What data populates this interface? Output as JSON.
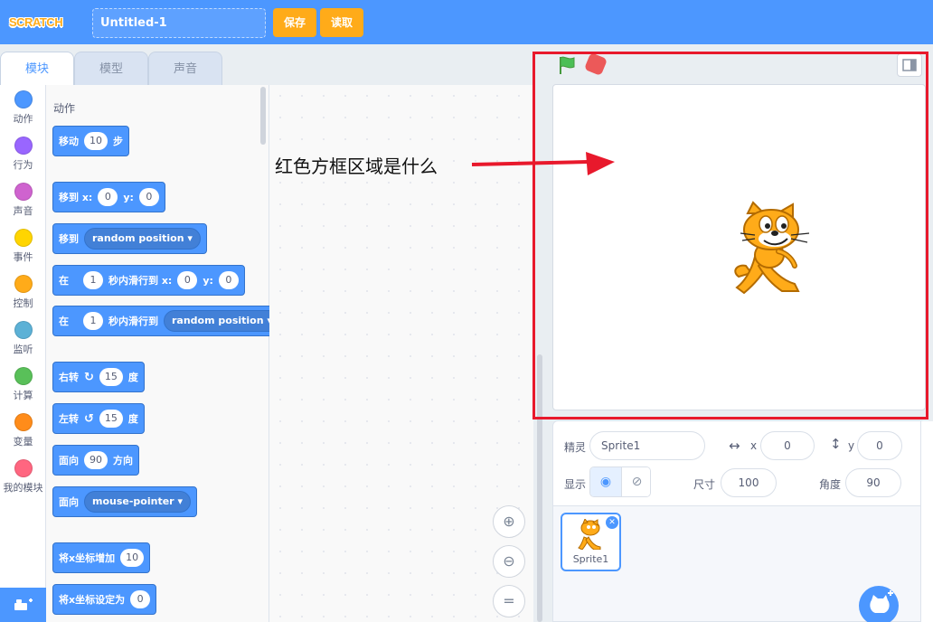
{
  "menubar": {
    "logo_text": "SCRATCH",
    "project_title": "Untitled-1",
    "save_label": "保存",
    "load_label": "读取"
  },
  "tabs": [
    "模块",
    "模型",
    "声音"
  ],
  "categories": [
    {
      "label": "动作",
      "color": "#4c97ff"
    },
    {
      "label": "行为",
      "color": "#9966ff"
    },
    {
      "label": "声音",
      "color": "#cf63cf"
    },
    {
      "label": "事件",
      "color": "#ffd500"
    },
    {
      "label": "控制",
      "color": "#ffab19"
    },
    {
      "label": "监听",
      "color": "#5cb1d6"
    },
    {
      "label": "计算",
      "color": "#59c059"
    },
    {
      "label": "变量",
      "color": "#ff8c1a"
    },
    {
      "label": "我的模块",
      "color": "#ff6680"
    }
  ],
  "palette": {
    "section_title": "动作",
    "blocks": {
      "move": {
        "label": "移动",
        "value": "10",
        "unit": "步"
      },
      "goto_xy": {
        "label": "移到 x:",
        "x": "0",
        "ylabel": "y:",
        "y": "0"
      },
      "goto": {
        "label": "移到",
        "dropdown": "random position"
      },
      "glide_xy": {
        "label": "在",
        "secs": "1",
        "mid": "秒内滑行到 x:",
        "x": "0",
        "ylabel": "y:",
        "y": "0"
      },
      "glide_to": {
        "label": "在",
        "secs": "1",
        "mid": "秒内滑行到",
        "dropdown": "random position"
      },
      "turn_right": {
        "label": "右转",
        "value": "15",
        "unit": "度"
      },
      "turn_left": {
        "label": "左转",
        "value": "15",
        "unit": "度"
      },
      "point_dir": {
        "label": "面向",
        "value": "90",
        "unit": "方向"
      },
      "point_towards": {
        "label": "面向",
        "dropdown": "mouse-pointer"
      },
      "change_x": {
        "label": "将x坐标增加",
        "value": "10"
      },
      "set_x": {
        "label": "将x坐标设定为",
        "value": "0"
      }
    }
  },
  "annotation": {
    "text": "红色方框区域是什么"
  },
  "sprite_info": {
    "sprite_label": "精灵",
    "sprite_name": "Sprite1",
    "x_label": "x",
    "x_value": "0",
    "y_label": "y",
    "y_value": "0",
    "show_label": "显示",
    "size_label": "尺寸",
    "size_value": "100",
    "direction_label": "角度",
    "direction_value": "90"
  },
  "sprite_list": {
    "tiles": [
      {
        "name": "Sprite1"
      }
    ]
  },
  "colors": {
    "accent": "#4c97ff",
    "highlight_frame": "#e8192c"
  }
}
